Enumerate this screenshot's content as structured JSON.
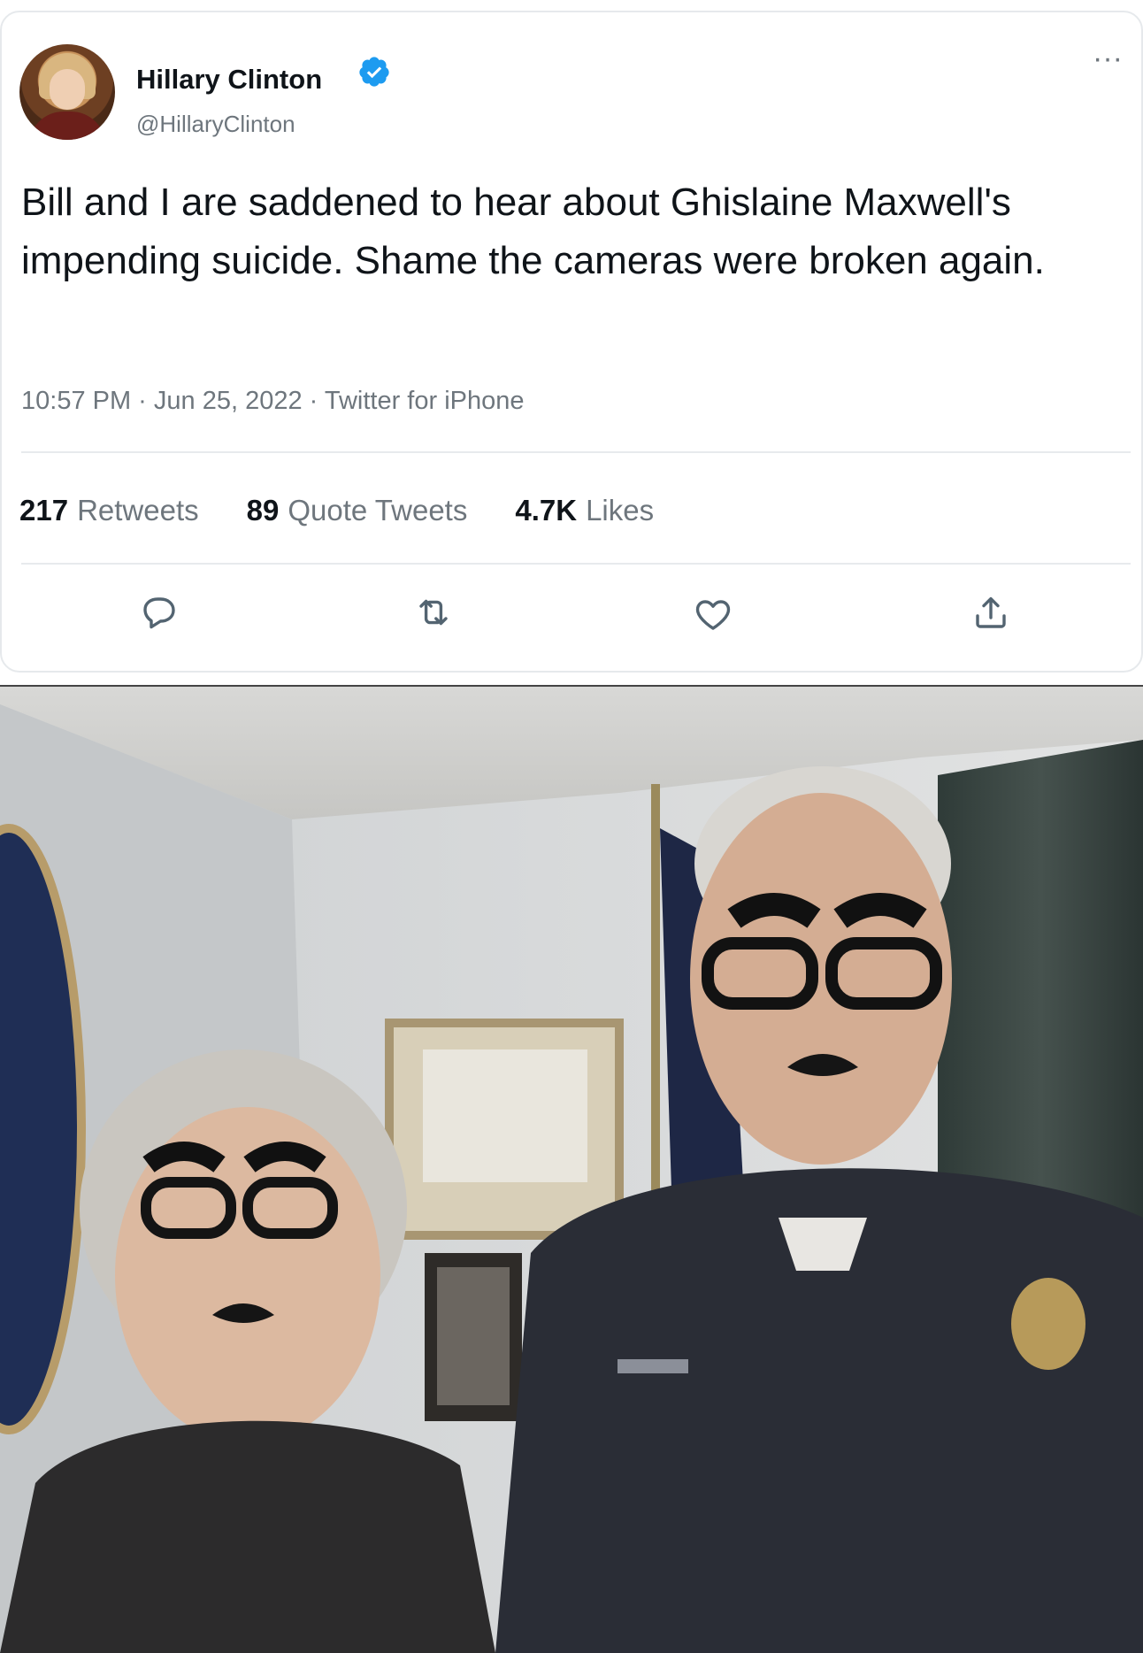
{
  "author": {
    "name": "Hillary Clinton",
    "handle": "@HillaryClinton",
    "verified": true
  },
  "tweet": {
    "text": "Bill and I are saddened to hear about Ghislaine Maxwell's impending suicide. Shame the cameras were broken again.",
    "meta": "10:57 PM · Jun 25, 2022 · Twitter for iPhone"
  },
  "stats": [
    {
      "count": "217",
      "label": "Retweets"
    },
    {
      "count": "89",
      "label": "Quote Tweets"
    },
    {
      "count": "4.7K",
      "label": "Likes"
    }
  ],
  "icons": {
    "more": "more-icon",
    "reply": "reply-icon",
    "retweet": "retweet-icon",
    "like": "heart-icon",
    "share": "share-icon"
  },
  "colors": {
    "verified": "#1d9bf0",
    "secondary_text": "#6e767d",
    "primary_text": "#0f1419"
  }
}
